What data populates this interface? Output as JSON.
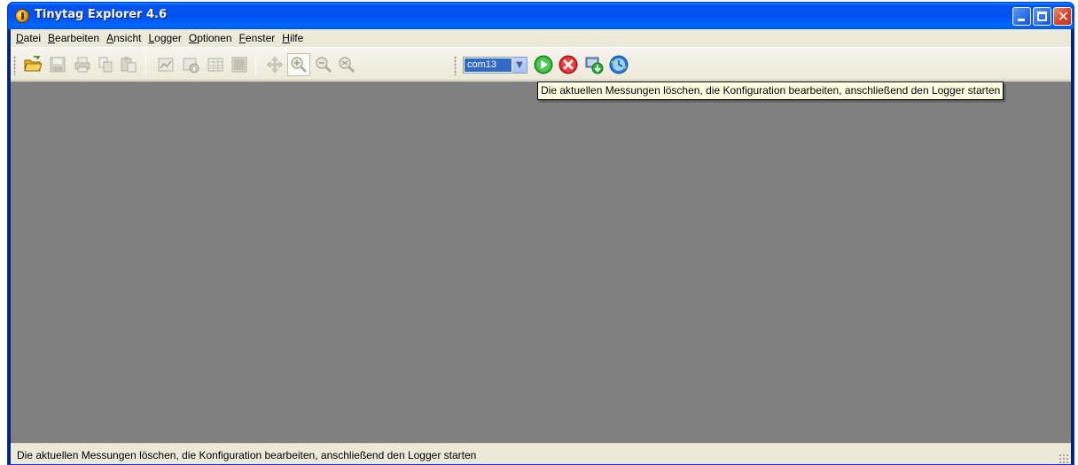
{
  "window": {
    "title": "Tinytag Explorer 4.6",
    "controls": {
      "minimize": "minimize",
      "maximize": "maximize",
      "close": "close"
    }
  },
  "menubar": {
    "items": [
      {
        "label": "Datei",
        "accesskey": "D"
      },
      {
        "label": "Bearbeiten",
        "accesskey": "B"
      },
      {
        "label": "Ansicht",
        "accesskey": "A"
      },
      {
        "label": "Logger",
        "accesskey": "L"
      },
      {
        "label": "Optionen",
        "accesskey": "O"
      },
      {
        "label": "Fenster",
        "accesskey": "F"
      },
      {
        "label": "Hilfe",
        "accesskey": "H"
      }
    ]
  },
  "toolbar": {
    "port_select": {
      "value": "com13"
    },
    "icons": [
      "open-folder-icon",
      "save-icon",
      "print-icon",
      "copy-icon",
      "paste-icon",
      "chart-icon",
      "info-icon",
      "table-icon",
      "summary-icon",
      "pan-icon",
      "zoom-in-icon",
      "zoom-out-icon",
      "zoom-reset-icon",
      "start-logger-icon",
      "stop-logger-icon",
      "download-icon",
      "clock-icon"
    ]
  },
  "tooltip": {
    "text": "Die aktuellen Messungen löschen, die Konfiguration bearbeiten, anschließend den Logger starten"
  },
  "statusbar": {
    "text": "Die aktuellen Messungen löschen, die Konfiguration bearbeiten, anschließend den Logger starten"
  },
  "colors": {
    "titlebar": "#0053ee",
    "workspace": "#808080",
    "chrome": "#ece9d8",
    "tooltip_bg": "#ffffe1",
    "combo_selected": "#316ac5"
  }
}
